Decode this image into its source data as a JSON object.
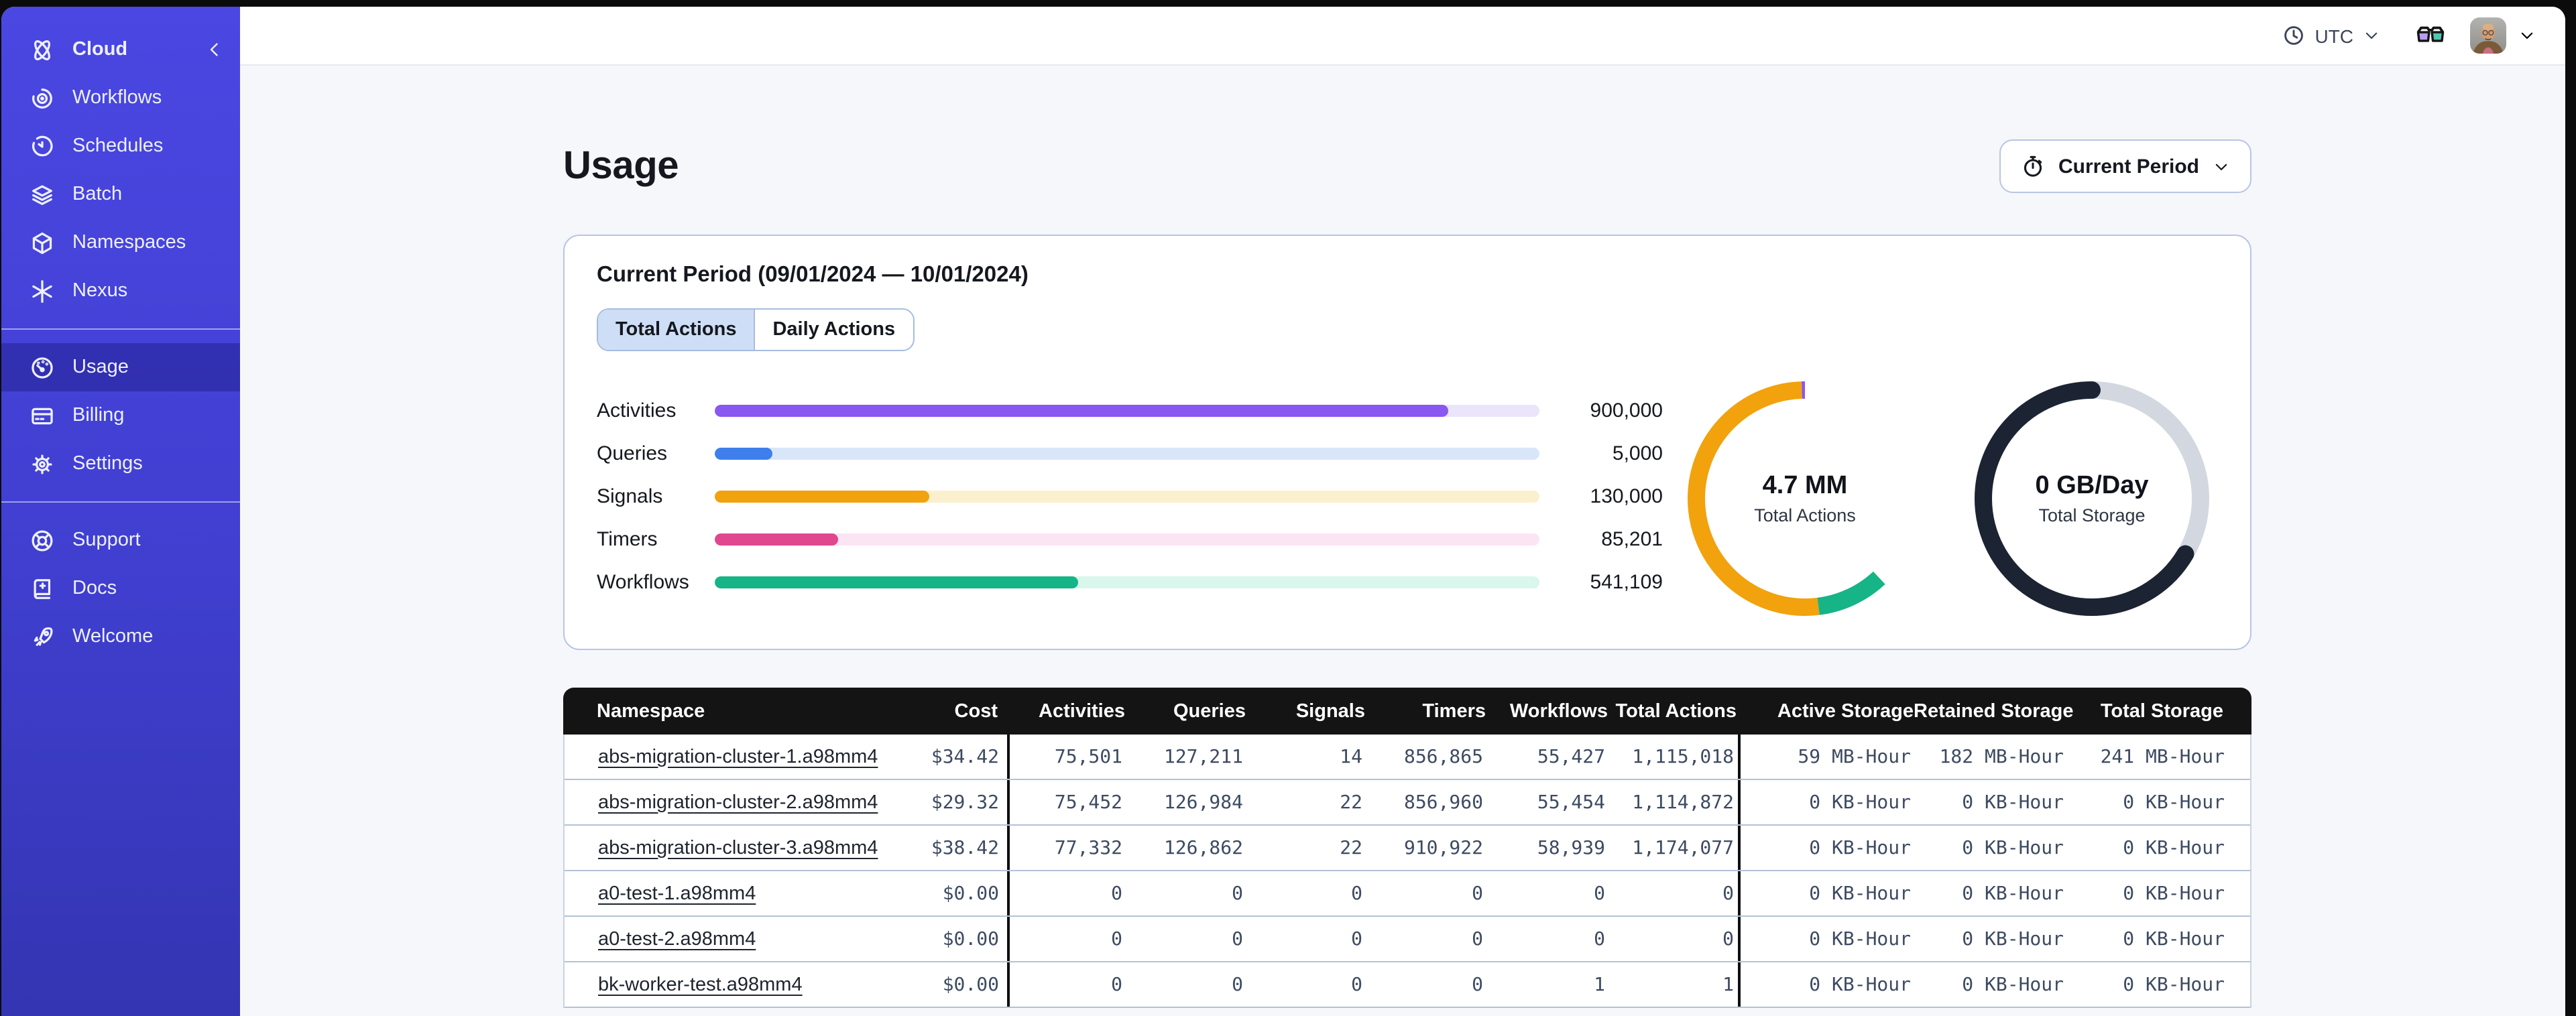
{
  "sidebar": {
    "header": {
      "label": "Cloud",
      "icon": "temporal-cloud"
    },
    "groups": [
      {
        "items": [
          {
            "label": "Workflows",
            "icon": "workflows",
            "active": false
          },
          {
            "label": "Schedules",
            "icon": "schedules",
            "active": false
          },
          {
            "label": "Batch",
            "icon": "batch",
            "active": false
          },
          {
            "label": "Namespaces",
            "icon": "namespaces",
            "active": false
          },
          {
            "label": "Nexus",
            "icon": "nexus",
            "active": false
          }
        ]
      },
      {
        "items": [
          {
            "label": "Usage",
            "icon": "usage",
            "active": true
          },
          {
            "label": "Billing",
            "icon": "billing",
            "active": false
          },
          {
            "label": "Settings",
            "icon": "settings",
            "active": false
          }
        ]
      },
      {
        "items": [
          {
            "label": "Support",
            "icon": "support",
            "active": false
          },
          {
            "label": "Docs",
            "icon": "docs",
            "active": false
          },
          {
            "label": "Welcome",
            "icon": "welcome",
            "active": false
          }
        ]
      }
    ]
  },
  "topbar": {
    "timezone": "UTC"
  },
  "page": {
    "title": "Usage",
    "period_button_label": "Current Period"
  },
  "panel": {
    "title": "Current Period (09/01/2024 — 10/01/2024)",
    "tabs": [
      {
        "label": "Total Actions",
        "active": true
      },
      {
        "label": "Daily Actions",
        "active": false
      }
    ],
    "bars": [
      {
        "label": "Activities",
        "value": "900,000",
        "pct": 89,
        "color": "#8a57f0",
        "track": "#eae5fb"
      },
      {
        "label": "Queries",
        "value": "5,000",
        "pct": 7,
        "color": "#3f7fec",
        "track": "#d9e6fa"
      },
      {
        "label": "Signals",
        "value": "130,000",
        "pct": 26,
        "color": "#f2a20d",
        "track": "#fbf0ce"
      },
      {
        "label": "Timers",
        "value": "85,201",
        "pct": 15,
        "color": "#e0478f",
        "track": "#fbe4f4"
      },
      {
        "label": "Workflows",
        "value": "541,109",
        "pct": 44,
        "color": "#16b487",
        "track": "#d9f7ec"
      }
    ],
    "donuts": [
      {
        "value": "4.7 MM",
        "label": "Total Actions",
        "segments": [
          {
            "color": "#8a57f0",
            "start": 0.995,
            "frac": 0.385,
            "cap": "butt"
          },
          {
            "color": "#16b487",
            "start": 0.38,
            "frac": 0.1,
            "cap": "butt"
          },
          {
            "color": "#f2a20d",
            "start": 0.48,
            "frac": 0.515,
            "cap": "butt"
          }
        ]
      },
      {
        "value": "0 GB/Day",
        "label": "Total Storage",
        "segments": [
          {
            "color": "#d3d8e0",
            "start": 0,
            "frac": 1,
            "cap": "butt"
          },
          {
            "color": "#1c2433",
            "start": 0.335,
            "frac": 0.675,
            "cap": "round"
          }
        ]
      }
    ]
  },
  "table": {
    "columns": [
      "Namespace",
      "Cost",
      "Activities",
      "Queries",
      "Signals",
      "Timers",
      "Workflows",
      "Total Actions",
      "Active Storage",
      "Retained Storage",
      "Total Storage"
    ],
    "rows": [
      {
        "namespace": "abs-migration-cluster-1.a98mm4",
        "cost": "$34.42",
        "activities": "75,501",
        "queries": "127,211",
        "signals": "14",
        "timers": "856,865",
        "workflows": "55,427",
        "total_actions": "1,115,018",
        "active_storage": "59 MB-Hour",
        "retained_storage": "182 MB-Hour",
        "total_storage": "241 MB-Hour"
      },
      {
        "namespace": "abs-migration-cluster-2.a98mm4",
        "cost": "$29.32",
        "activities": "75,452",
        "queries": "126,984",
        "signals": "22",
        "timers": "856,960",
        "workflows": "55,454",
        "total_actions": "1,114,872",
        "active_storage": "0 KB-Hour",
        "retained_storage": "0 KB-Hour",
        "total_storage": "0 KB-Hour"
      },
      {
        "namespace": "abs-migration-cluster-3.a98mm4",
        "cost": "$38.42",
        "activities": "77,332",
        "queries": "126,862",
        "signals": "22",
        "timers": "910,922",
        "workflows": "58,939",
        "total_actions": "1,174,077",
        "active_storage": "0 KB-Hour",
        "retained_storage": "0 KB-Hour",
        "total_storage": "0 KB-Hour"
      },
      {
        "namespace": "a0-test-1.a98mm4",
        "cost": "$0.00",
        "activities": "0",
        "queries": "0",
        "signals": "0",
        "timers": "0",
        "workflows": "0",
        "total_actions": "0",
        "active_storage": "0 KB-Hour",
        "retained_storage": "0 KB-Hour",
        "total_storage": "0 KB-Hour"
      },
      {
        "namespace": "a0-test-2.a98mm4",
        "cost": "$0.00",
        "activities": "0",
        "queries": "0",
        "signals": "0",
        "timers": "0",
        "workflows": "0",
        "total_actions": "0",
        "active_storage": "0 KB-Hour",
        "retained_storage": "0 KB-Hour",
        "total_storage": "0 KB-Hour"
      },
      {
        "namespace": "bk-worker-test.a98mm4",
        "cost": "$0.00",
        "activities": "0",
        "queries": "0",
        "signals": "0",
        "timers": "0",
        "workflows": "1",
        "total_actions": "1",
        "active_storage": "0 KB-Hour",
        "retained_storage": "0 KB-Hour",
        "total_storage": "0 KB-Hour"
      }
    ]
  }
}
